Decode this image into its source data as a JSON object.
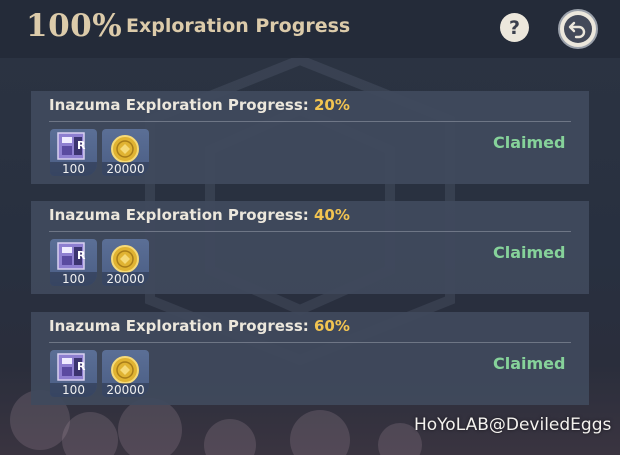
{
  "header": {
    "progress_value": "100%",
    "title": "Exploration Progress",
    "help_icon": "question-mark-icon",
    "back_icon": "return-arrow-icon"
  },
  "rewards": [
    {
      "label": "Inazuma Exploration Progress: ",
      "percent": "20%",
      "items": [
        {
          "icon": "primogem-wish-item-icon",
          "count": "100"
        },
        {
          "icon": "mora-coin-icon",
          "count": "20000"
        }
      ],
      "status": "Claimed"
    },
    {
      "label": "Inazuma Exploration Progress: ",
      "percent": "40%",
      "items": [
        {
          "icon": "primogem-wish-item-icon",
          "count": "100"
        },
        {
          "icon": "mora-coin-icon",
          "count": "20000"
        }
      ],
      "status": "Claimed"
    },
    {
      "label": "Inazuma Exploration Progress: ",
      "percent": "60%",
      "items": [
        {
          "icon": "primogem-wish-item-icon",
          "count": "100"
        },
        {
          "icon": "mora-coin-icon",
          "count": "20000"
        }
      ],
      "status": "Claimed"
    }
  ],
  "watermark": "HoYoLAB@DeviledEggs",
  "colors": {
    "accent_gold": "#dccbaa",
    "percent_yellow": "#f2c451",
    "claimed_green": "#86d29a",
    "card_bg": "#40495c"
  }
}
